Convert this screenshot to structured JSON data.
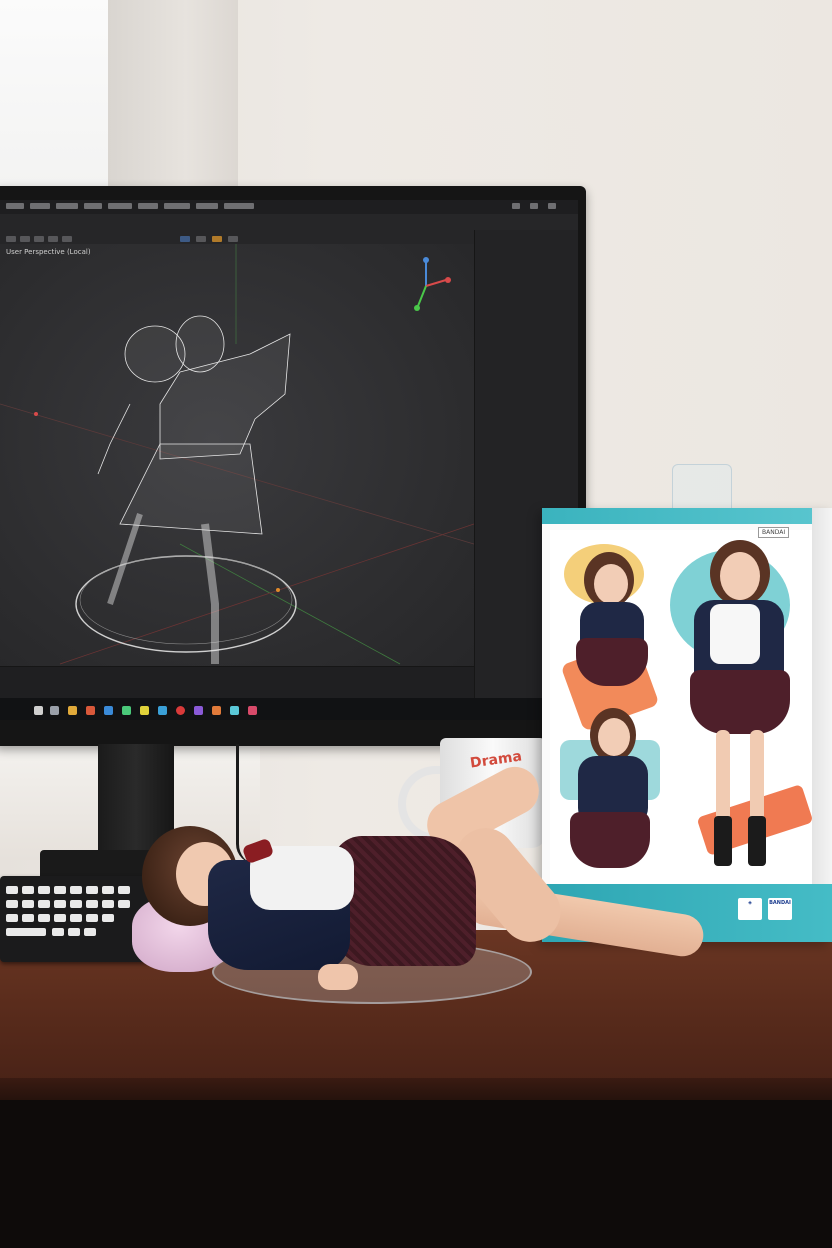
{
  "scene": {
    "description_colors": {
      "wall": "#ece7e1",
      "desk": "#5a2c1c",
      "viewport": "#2c2c2e",
      "box_accent": "#3ab3be",
      "skirt": "#4e1f2a",
      "jacket": "#1f2845"
    }
  },
  "monitor": {
    "viewport_label": "User Perspective (Local)",
    "icons": [
      "wireframe-figure-icon",
      "navigation-gizmo-icon",
      "outliner-panel",
      "taskbar"
    ]
  },
  "mug": {
    "print_text": "Drama"
  },
  "box": {
    "brand_tag": "BANDAI",
    "small_text": "",
    "logo_right": "BANDAI"
  }
}
